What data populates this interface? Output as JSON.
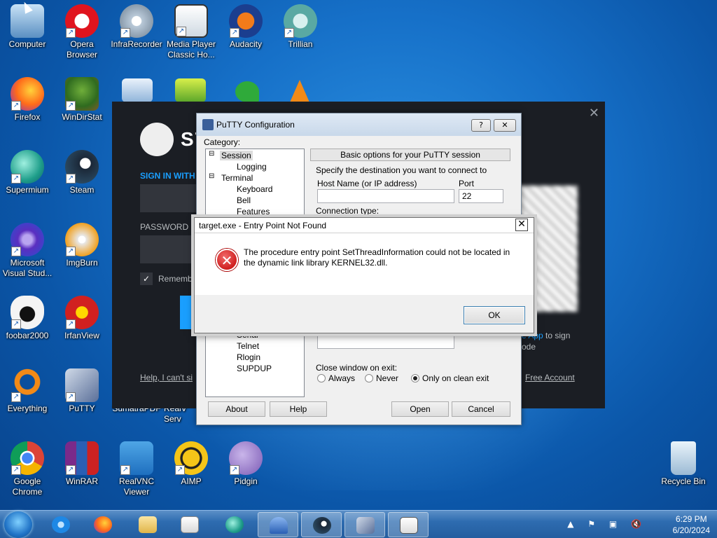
{
  "desktop": {
    "icons": [
      {
        "label": "Computer"
      },
      {
        "label": "Opera Browser"
      },
      {
        "label": "InfraRecorder"
      },
      {
        "label": "Media Player Classic Ho..."
      },
      {
        "label": "Audacity"
      },
      {
        "label": "Trillian"
      },
      {
        "label": "Firefox"
      },
      {
        "label": "WinDirStat"
      },
      {
        "label": "Supermium"
      },
      {
        "label": "Steam"
      },
      {
        "label": "Microsoft Visual Stud..."
      },
      {
        "label": "ImgBurn"
      },
      {
        "label": "foobar2000"
      },
      {
        "label": "IrfanView"
      },
      {
        "label": "Everything"
      },
      {
        "label": "PuTTY"
      },
      {
        "label": "Google Chrome"
      },
      {
        "label": "WinRAR"
      },
      {
        "label": "RealVNC Viewer"
      },
      {
        "label": "AIMP"
      },
      {
        "label": "Pidgin"
      },
      {
        "label": "Recycle Bin"
      }
    ],
    "partial_labels": {
      "sumatra": "SumatraPDF",
      "realv": "RealV",
      "serv": "Serv"
    }
  },
  "steam": {
    "logo_text": "ST",
    "sign_in": "SIGN IN WITH",
    "password_label": "PASSWORD",
    "remember": "Rememb",
    "help_link": "Help, I can't si",
    "qr_text_app": "e App",
    "qr_text_1": " to sign",
    "qr_text_2": "ode",
    "free_account": "Free Account",
    "close": "✕",
    "checkbox": "✓"
  },
  "putty": {
    "title": "PuTTY Configuration",
    "help_btn": "?",
    "close_btn": "✕",
    "category_label": "Category:",
    "tree_top": [
      "Session",
      "Logging",
      "Terminal",
      "Keyboard",
      "Bell",
      "Features"
    ],
    "tree_bottom": [
      "Serial",
      "Telnet",
      "Rlogin",
      "SUPDUP"
    ],
    "panel_title": "Basic options for your PuTTY session",
    "destination_label": "Specify the destination you want to connect to",
    "host_label": "Host Name (or IP address)",
    "port_label": "Port",
    "host_value": "",
    "port_value": "22",
    "conn_type_label": "Connection type:",
    "close_window_label": "Close window on exit:",
    "radio_always": "Always",
    "radio_never": "Never",
    "radio_clean": "Only on clean exit",
    "about": "About",
    "help": "Help",
    "open": "Open",
    "cancel": "Cancel"
  },
  "error_dialog": {
    "title": "target.exe - Entry Point Not Found",
    "close": "✕",
    "icon": "✕",
    "message": "The procedure entry point SetThreadInformation could not be located in the dynamic link library KERNEL32.dll.",
    "ok": "OK"
  },
  "taskbar": {
    "time": "6:29 PM",
    "date": "6/20/2024",
    "tray": "▲ ⚑ ▣ 🔇"
  }
}
